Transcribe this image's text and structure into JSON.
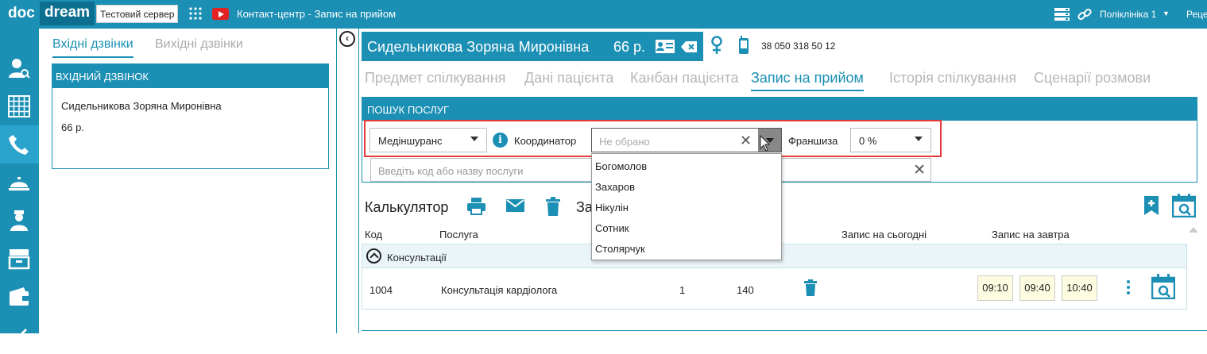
{
  "topbar": {
    "logo_doc": "doc",
    "logo_dream": "dream",
    "server_badge": "Тестовий сервер",
    "title": "Контакт-центр - Запис на прийом",
    "clinic": "Поліклініка 1",
    "user_cut": "Реце"
  },
  "calls": {
    "tabs": [
      {
        "label": "Вхідні дзвінки",
        "active": true
      },
      {
        "label": "Вихідні дзвінки",
        "active": false
      }
    ],
    "incoming_header": "ВХІДНИЙ ДЗВІНОК",
    "caller_name": "Сидельникова Зоряна Миронівна",
    "caller_age": "66 р."
  },
  "patient": {
    "name": "Сидельникова Зоряна Миронівна",
    "age": "66 р.",
    "phone": "38 050 318 50 12"
  },
  "main_tabs": [
    {
      "label": "Предмет спілкування"
    },
    {
      "label": "Дані пацієнта"
    },
    {
      "label": "Канбан пацієнта"
    },
    {
      "label": "Запис на прийом",
      "active": true
    },
    {
      "label": "Історія спілкування"
    },
    {
      "label": "Сценарії розмови"
    }
  ],
  "search": {
    "header": "ПОШУК ПОСЛУГ",
    "insurer_value": "Медіншуранс",
    "coordinator_label": "Координатор",
    "coordinator_placeholder": "Не обрано",
    "franchise_label": "Франшиза",
    "franchise_value": "0 %",
    "service_placeholder": "Введіть код або назву послуги",
    "coordinator_options": [
      "Богомолов",
      "Захаров",
      "Нікулін",
      "Сотник",
      "Столярчук"
    ]
  },
  "calculator": {
    "title": "Калькулятор",
    "title_cut": "За",
    "columns": {
      "code": "Код",
      "service": "Послуга",
      "today": "Запис на сьогодні",
      "tomorrow": "Запис на завтра"
    },
    "group": "Консультації",
    "rows": [
      {
        "code": "1004",
        "service": "Консультація кардіолога",
        "qty": "1",
        "price": "140",
        "slots": [
          "09:10",
          "09:40",
          "10:40"
        ]
      }
    ]
  },
  "colors": {
    "accent": "#1b8fb4",
    "highlight_border": "#e63939",
    "slot_bg": "#fdfbe0"
  }
}
